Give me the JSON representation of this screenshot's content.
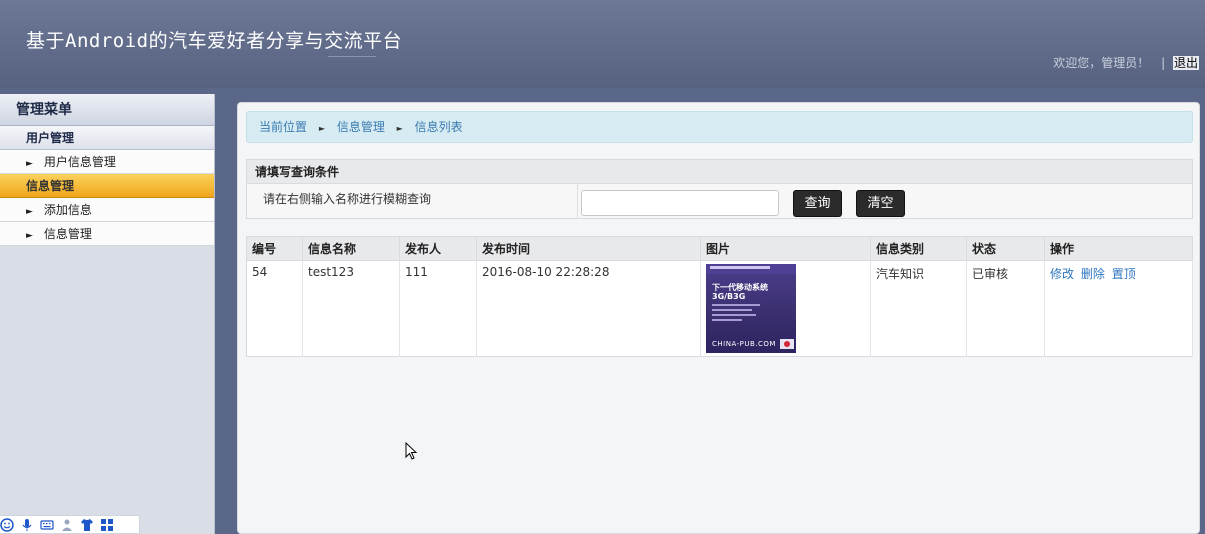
{
  "header": {
    "app_title": "基于Android的汽车爱好者分享与交流平台",
    "welcome": "欢迎您，管理员！",
    "separator": "|",
    "logout": "退出"
  },
  "sidebar": {
    "heading": "管理菜单",
    "groups": [
      {
        "label": "用户管理",
        "active": false,
        "items": [
          {
            "label": "用户信息管理"
          }
        ]
      },
      {
        "label": "信息管理",
        "active": true,
        "items": [
          {
            "label": "添加信息"
          },
          {
            "label": "信息管理"
          }
        ]
      }
    ]
  },
  "breadcrumb": {
    "items": [
      "当前位置",
      "信息管理",
      "信息列表"
    ]
  },
  "query": {
    "heading": "请填写查询条件",
    "hint": "请在右侧输入名称进行模糊查询",
    "input_value": "",
    "query_button": "查询",
    "clear_button": "清空"
  },
  "table": {
    "headers": [
      "编号",
      "信息名称",
      "发布人",
      "发布时间",
      "图片",
      "信息类别",
      "状态",
      "操作"
    ],
    "rows": [
      {
        "id": "54",
        "name": "test123",
        "publisher": "111",
        "time": "2016-08-10 22:28:28",
        "image": {
          "title_line1": "下一代移动系统",
          "title_line2": "3G/B3G",
          "brand": "CHINA-PUB.COM"
        },
        "category": "汽车知识",
        "status": "已审核",
        "actions": [
          "修改",
          "删除",
          "置顶"
        ]
      }
    ]
  },
  "colors": {
    "header_bg": "#5f6b8a",
    "active_menu": "#f0a51c",
    "link": "#2f76c0",
    "status_ok": "#2ba64c",
    "breadcrumb_bg": "#d6ebf2"
  },
  "ime_toolbar": {
    "icons": [
      "smiley-icon",
      "microphone-icon",
      "keyboard-icon",
      "user-icon",
      "shirt-icon",
      "grid-icon"
    ]
  }
}
